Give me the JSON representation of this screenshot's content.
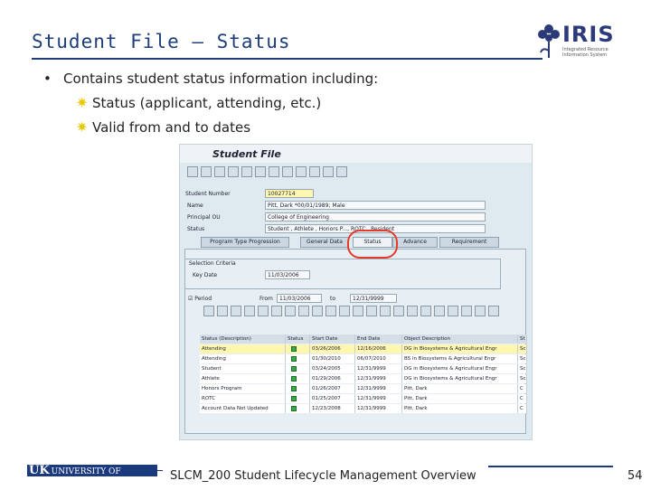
{
  "slide": {
    "title": "Student File – Status",
    "bullet": "Contains student status information including:",
    "sub_bullets": [
      "Status (applicant, attending, etc.)",
      "Valid from and to dates"
    ],
    "footer": "SLCM_200 Student Lifecycle Management Overview",
    "page_number": "54"
  },
  "logos": {
    "iris_word": "IRIS",
    "iris_sub": "Integrated Resource Information System",
    "uk_initials": "UK",
    "uk_name": "UNIVERSITY OF KENTUCKY"
  },
  "sap": {
    "window_title": "Student File",
    "fields": {
      "student_number_label": "Student Number",
      "student_number_value": "10027714",
      "name_label": "Name",
      "name_value": "Pitt, Dark *00/01/1989; Male",
      "principal_ou_label": "Principal OU",
      "principal_ou_value": "College of Engineering",
      "status_label": "Status",
      "status_value": "Student , Athlete , Honors P..., ROTC , Resident"
    },
    "tabs": [
      "Program Type Progression",
      "General Data",
      "Status",
      "Advance",
      "Requirement"
    ],
    "selection_criteria_label": "Selection Criteria",
    "key_date_label": "Key Date",
    "key_date_value": "11/03/2006",
    "period_label": "Period",
    "from_label": "From",
    "from_value": "11/03/2006",
    "to_label": "to",
    "to_value": "12/31/9999",
    "grid_headers": [
      "Status (Description)",
      "Status",
      "Start Date",
      "End Date",
      "Object Description",
      "St"
    ],
    "grid_rows": [
      {
        "desc": "Attending",
        "start": "03/26/2006",
        "end": "12/16/2006",
        "object": "DG in Biosystems & Agricultural Engr",
        "st": "Sc"
      },
      {
        "desc": "Attending",
        "start": "01/30/2010",
        "end": "06/07/2010",
        "object": "BS in Biosystems & Agricultural Engr",
        "st": "Sc"
      },
      {
        "desc": "Student",
        "start": "03/24/2005",
        "end": "12/31/9999",
        "object": "DG in Biosystems & Agricultural Engr",
        "st": "Sc"
      },
      {
        "desc": "Athlete",
        "start": "01/29/2006",
        "end": "12/31/9999",
        "object": "DG in Biosystems & Agricultural Engr",
        "st": "Sc"
      },
      {
        "desc": "Honors Program",
        "start": "01/26/2007",
        "end": "12/31/9999",
        "object": "Pitt, Dark",
        "st": "C"
      },
      {
        "desc": "ROTC",
        "start": "01/25/2007",
        "end": "12/31/9999",
        "object": "Pitt, Dark",
        "st": "C"
      },
      {
        "desc": "Account Data Not Updated",
        "start": "12/23/2008",
        "end": "12/31/9999",
        "object": "Pitt, Dark",
        "st": "C"
      }
    ]
  }
}
